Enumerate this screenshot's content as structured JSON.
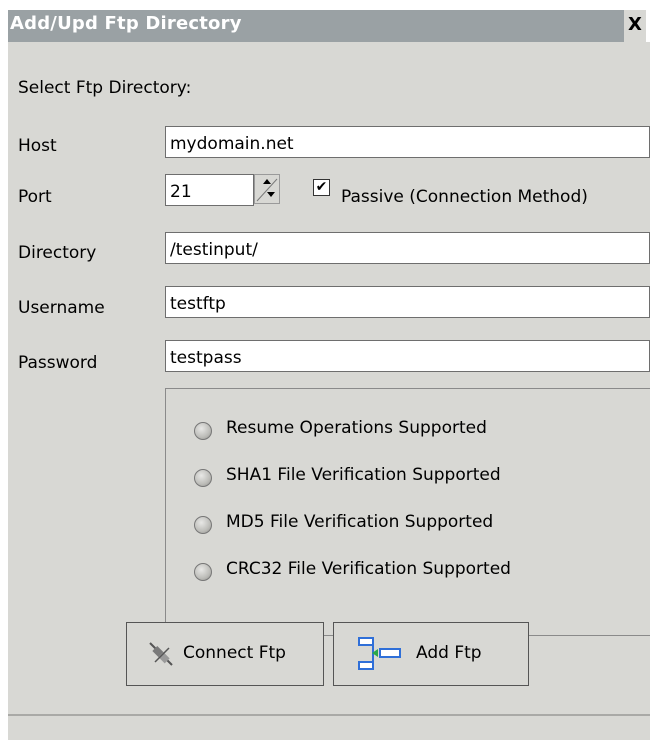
{
  "window": {
    "title": "Add/Upd Ftp Directory",
    "close_label": "X"
  },
  "form": {
    "section_label": "Select Ftp Directory:",
    "host": {
      "label": "Host",
      "value": "mydomain.net"
    },
    "port": {
      "label": "Port",
      "value": "21"
    },
    "passive": {
      "label": "Passive (Connection Method)",
      "checked": true
    },
    "directory": {
      "label": "Directory",
      "value": "/testinput/"
    },
    "username": {
      "label": "Username",
      "value": "testftp"
    },
    "password": {
      "label": "Password",
      "value": "testpass"
    }
  },
  "capabilities": [
    {
      "label": "Resume Operations Supported",
      "checked": false
    },
    {
      "label": "SHA1 File Verification Supported",
      "checked": false
    },
    {
      "label": "MD5 File Verification Supported",
      "checked": false
    },
    {
      "label": "CRC32 File Verification Supported",
      "checked": false
    }
  ],
  "buttons": {
    "connect_label": "Connect Ftp",
    "add_label": "Add Ftp"
  }
}
